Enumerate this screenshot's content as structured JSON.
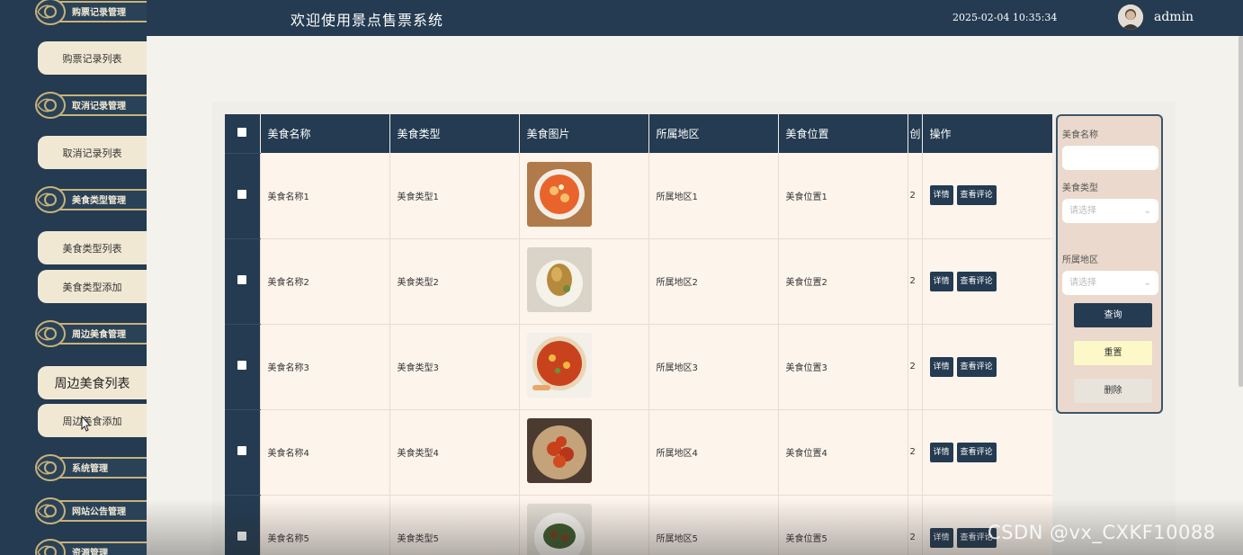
{
  "header": {
    "title": "欢迎使用景点售票系统",
    "datetime": "2025-02-04 10:35:34",
    "username": "admin"
  },
  "sidebar": {
    "groups": [
      {
        "label": "购票记录管理"
      },
      {
        "label": "取消记录管理"
      },
      {
        "label": "美食类型管理"
      },
      {
        "label": "周边美食管理"
      },
      {
        "label": "系统管理"
      },
      {
        "label": "网站公告管理"
      },
      {
        "label": "资源管理"
      }
    ],
    "items": [
      {
        "label": "购票记录列表"
      },
      {
        "label": "取消记录列表"
      },
      {
        "label": "美食类型列表"
      },
      {
        "label": "美食类型添加"
      },
      {
        "label": "周边美食列表"
      },
      {
        "label": "周边美食添加"
      }
    ]
  },
  "table": {
    "columns": [
      "美食名称",
      "美食类型",
      "美食图片",
      "所属地区",
      "美食位置",
      "创",
      "操作"
    ],
    "rows": [
      {
        "name": "美食名称1",
        "type": "美食类型1",
        "region": "所属地区1",
        "location": "美食位置1",
        "extra": "2"
      },
      {
        "name": "美食名称2",
        "type": "美食类型2",
        "region": "所属地区2",
        "location": "美食位置2",
        "extra": "2"
      },
      {
        "name": "美食名称3",
        "type": "美食类型3",
        "region": "所属地区3",
        "location": "美食位置3",
        "extra": "2"
      },
      {
        "name": "美食名称4",
        "type": "美食类型4",
        "region": "所属地区4",
        "location": "美食位置4",
        "extra": "2"
      },
      {
        "name": "美食名称5",
        "type": "美食类型5",
        "region": "所属地区5",
        "location": "美食位置5",
        "extra": "2"
      }
    ],
    "actions": {
      "detail": "详情",
      "reviews": "查看评论"
    }
  },
  "search": {
    "name_label": "美食名称",
    "name_value": "",
    "type_label": "美食类型",
    "type_placeholder": "请选择",
    "region_label": "所属地区",
    "region_placeholder": "请选择",
    "query_button": "查询",
    "reset_button": "重置",
    "delete_button": "删除"
  },
  "watermark": "CSDN @vx_CXKF10088",
  "colors": {
    "sidebar_bg": "#243b51",
    "menu_item_bg": "#f1e8d4",
    "gold_border": "#c8b27a",
    "row_bg": "#fdf4ec",
    "reset_bg": "#fcf8c8"
  }
}
